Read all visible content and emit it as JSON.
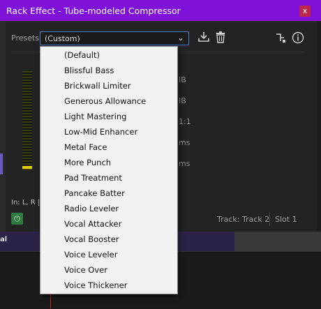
{
  "window": {
    "title": "Rack Effect - Tube-modeled Compressor",
    "close_glyph": "x"
  },
  "presets": {
    "label": "Presets:",
    "selected": "(Custom)",
    "options": [
      "(Default)",
      "Blissful Bass",
      "Brickwall Limiter",
      "Generous Allowance",
      "Light Mastering",
      "Low-Mid Enhancer",
      "Metal Face",
      "More Punch",
      "Pad Treatment",
      "Pancake Batter",
      "Radio Leveler",
      "Vocal Attacker",
      "Vocal Booster",
      "Voice Leveler",
      "Voice Over",
      "Voice Thickener"
    ]
  },
  "toolbar": {
    "save_icon": "download-icon",
    "delete_icon": "trash-icon",
    "routing_icon": "routing-icon",
    "info_icon": "info-icon"
  },
  "partial_units": [
    "IB",
    "IB",
    "1:1",
    "ms",
    "ms"
  ],
  "footer": {
    "input_label": "In: L, R |",
    "track": "Track: Track 2",
    "slot": "Slot 1"
  },
  "background": {
    "track_label": "al"
  },
  "colors": {
    "titlebar": "#7f12d9",
    "close": "#c0254b",
    "power": "#2f7a40",
    "meter": "#e6d000"
  }
}
